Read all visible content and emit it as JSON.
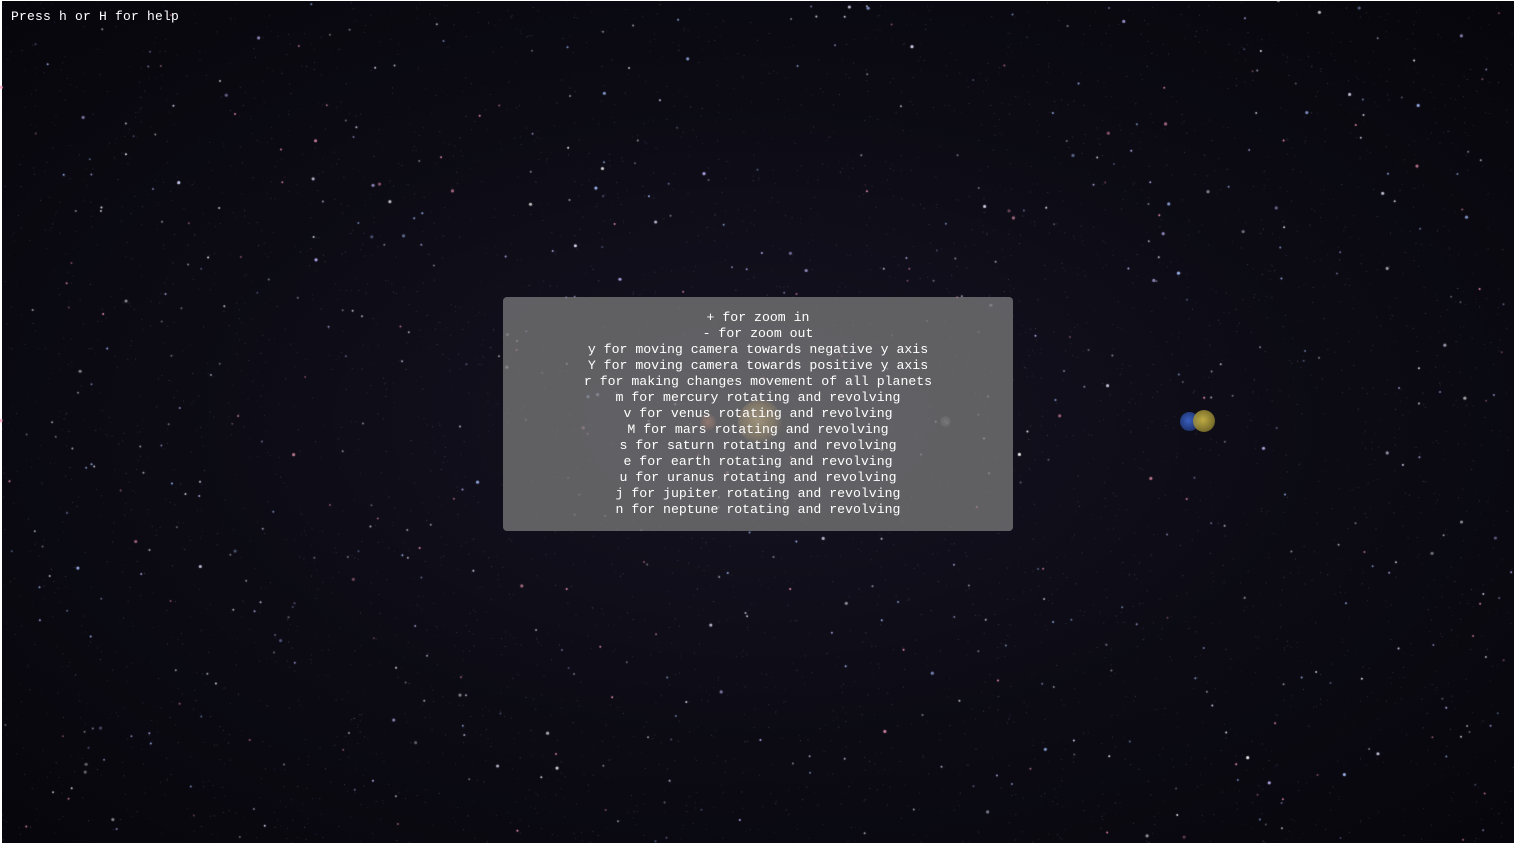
{
  "hud": {
    "help_hint": "Press h or H for help"
  },
  "help_panel": {
    "lines": [
      "+ for zoom in",
      "- for zoom out",
      "y for moving camera towards negative y axis",
      "Y for moving camera towards positive y axis",
      "r for making changes movement of all planets",
      "m for mercury rotating and revolving",
      "v for venus rotating and revolving",
      "M for mars rotating and revolving",
      "s for saturn rotating and revolving",
      "e for earth rotating and revolving",
      "u for uranus rotating and revolving",
      "j for jupiter rotating and revolving",
      "n for neptune rotating and revolving"
    ]
  },
  "scene": {
    "background_color": "#0b0a12",
    "sun_color": "#ecb046",
    "earth_color": "#3a5fc0",
    "moon_color": "#c8b446",
    "star_colors": [
      "#ffffff",
      "#c9b8ff",
      "#ff9fc0",
      "#a8c0ff",
      "#e6e6ff"
    ]
  }
}
